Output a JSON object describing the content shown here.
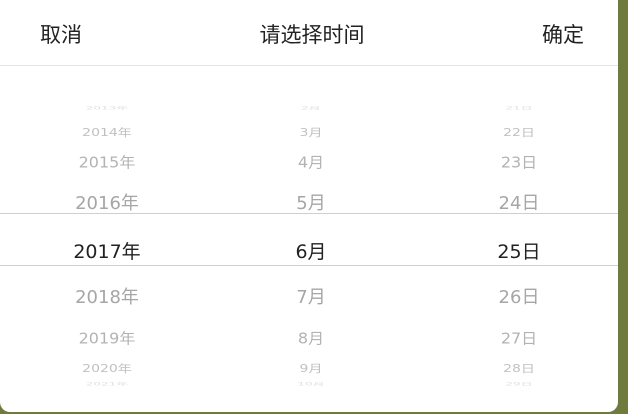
{
  "header": {
    "cancel_label": "取消",
    "title": "请选择时间",
    "confirm_label": "确定"
  },
  "picker": {
    "selected": {
      "year": "2017年",
      "month": "6月",
      "day": "25日"
    },
    "columns": {
      "year": [
        "2013年",
        "2014年",
        "2015年",
        "2016年",
        "2017年",
        "2018年",
        "2019年",
        "2020年",
        "2021年"
      ],
      "month": [
        "2月",
        "3月",
        "4月",
        "5月",
        "6月",
        "7月",
        "8月",
        "9月",
        "10月"
      ],
      "day": [
        "21日",
        "22日",
        "23日",
        "24日",
        "25日",
        "26日",
        "27日",
        "28日",
        "29日"
      ]
    }
  },
  "colors": {
    "selected_text": "#222222",
    "unselected_text": "#a6a6a6",
    "divider": "#cfcfcf",
    "backdrop": "#6f7a3d"
  }
}
